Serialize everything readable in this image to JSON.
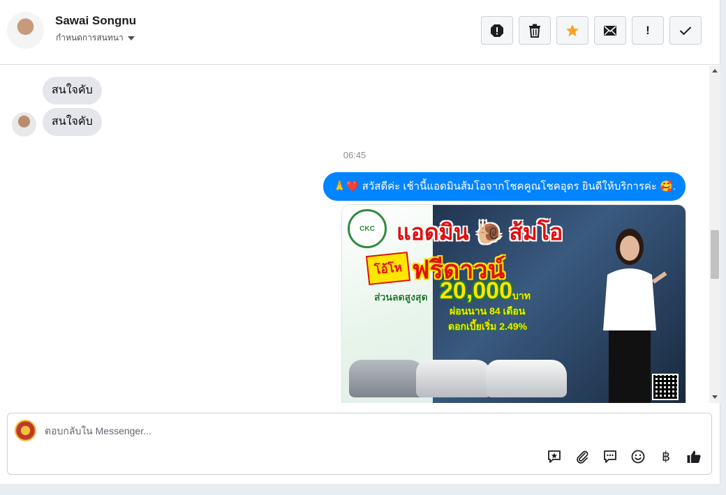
{
  "header": {
    "contact_name": "Sawai Songnu",
    "assign_label": "กำหนดการสนทนา"
  },
  "toolbar": {
    "icons": [
      "spam-icon",
      "trash-icon",
      "star-icon",
      "mail-icon",
      "important-icon",
      "check-icon"
    ],
    "important_glyph": "!"
  },
  "messages": {
    "incoming": [
      {
        "text": "สนใจคับ"
      },
      {
        "text": "สนใจคับ"
      }
    ],
    "timestamp": "06:45",
    "outgoing_text": "🙏❤️ สวัสดีค่ะ เช้านี้แอดมินส้มโอจากโชคคูณโชคอุดร ยินดีให้บริการค่ะ 🥰.",
    "promo": {
      "headline": "แอดมิน 🐌 ส้มโอ",
      "badge": "โอ้โห",
      "offer": "ฟรีดาวน์",
      "discount_label": "ส่วนลดสูงสุด",
      "discount_amount": "20,000",
      "currency_word": "บาท",
      "installment": "ผ่อนนาน 84 เดือน",
      "interest": "ดอกเบี้ยเริ่ม 2.49%",
      "logo_text": "CKC"
    }
  },
  "composer": {
    "placeholder": "ตอบกลับใน Messenger...",
    "baht_glyph": "฿"
  },
  "colors": {
    "accent": "#0084ff",
    "incoming_bubble": "#e4e6eb",
    "star": "#f5a623"
  }
}
